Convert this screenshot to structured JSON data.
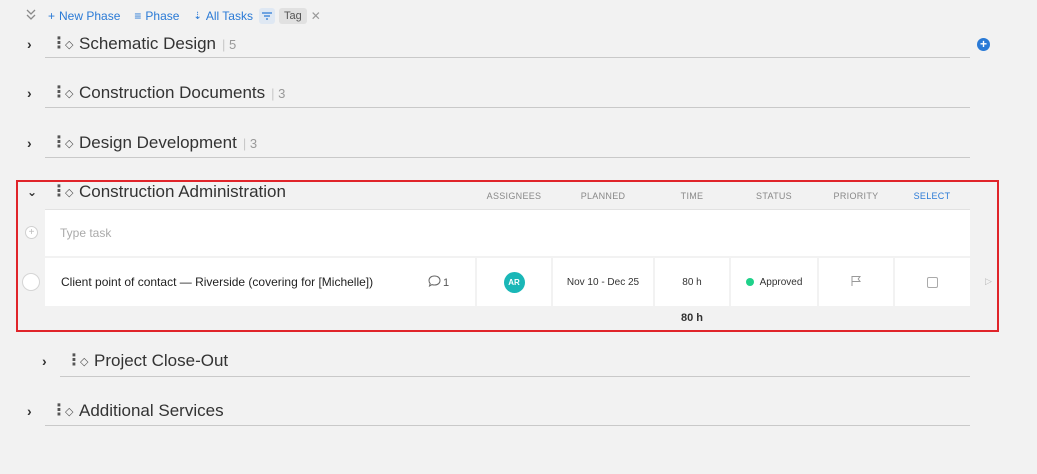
{
  "toolbar": {
    "new_phase": "New Phase",
    "phase": "Phase",
    "all_tasks": "All Tasks",
    "tag": "Tag"
  },
  "phases": [
    {
      "title": "Schematic Design",
      "count": "5",
      "expanded": false
    },
    {
      "title": "Construction Documents",
      "count": "3",
      "expanded": false
    },
    {
      "title": "Design Development",
      "count": "3",
      "expanded": false
    },
    {
      "title": "Construction Administration",
      "count": "",
      "expanded": true
    },
    {
      "title": "Project Close-Out",
      "count": "",
      "expanded": false
    },
    {
      "title": "Additional Services",
      "count": "",
      "expanded": false
    }
  ],
  "columns": {
    "assignees": "ASSIGNEES",
    "planned": "PLANNED",
    "time": "TIME",
    "status": "STATUS",
    "priority": "PRIORITY",
    "select": "SELECT"
  },
  "type_task_placeholder": "Type task",
  "task": {
    "name": "Client point of contact — Riverside (covering for [Michelle])",
    "comments": "1",
    "assignee_initials": "AR",
    "planned": "Nov 10 - Dec 25",
    "time": "80 h",
    "status": "Approved"
  },
  "total_time": "80 h",
  "colors": {
    "accent": "#2a7ad6",
    "highlight": "#e0242a",
    "avatar": "#1ab7b7",
    "status_approved": "#1fd18a"
  }
}
